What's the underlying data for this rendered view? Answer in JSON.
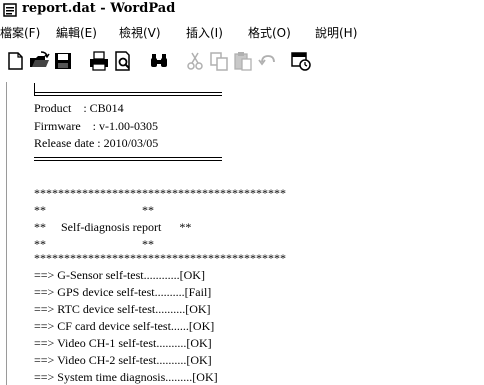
{
  "window": {
    "title": "report.dat - WordPad"
  },
  "menu": [
    {
      "label": "檔案(F)"
    },
    {
      "label": "編輯(E)"
    },
    {
      "label": "檢視(V)"
    },
    {
      "label": "插入(I)"
    },
    {
      "label": "格式(O)"
    },
    {
      "label": "說明(H)"
    }
  ],
  "toolbar": [
    {
      "icon": "new-document-icon"
    },
    {
      "icon": "open-folder-icon"
    },
    {
      "icon": "save-icon"
    },
    {
      "icon": "print-icon"
    },
    {
      "icon": "print-preview-icon"
    },
    {
      "icon": "find-icon"
    },
    {
      "icon": "cut-icon"
    },
    {
      "icon": "copy-icon"
    },
    {
      "icon": "paste-icon"
    },
    {
      "icon": "undo-icon"
    },
    {
      "icon": "insert-datetime-icon"
    }
  ],
  "document": {
    "header_lines": [
      "Product    : CB014",
      "Firmware    : v-1.00-0305",
      "Release date : 2010/03/05"
    ],
    "stars_line": "******************************************",
    "banner_lines": [
      "**                                **",
      "**     Self-diagnosis report      **",
      "**                                **"
    ],
    "results": [
      "==> G-Sensor self-test............[OK]",
      "==> GPS device self-test..........[Fail]",
      "==> RTC device self-test..........[OK]",
      "==> CF card device self-test......[OK]",
      "==> Video CH-1 self-test..........[OK]",
      "==> Video CH-2 self-test..........[OK]",
      "==> System time diagnosis.........[OK]"
    ]
  }
}
